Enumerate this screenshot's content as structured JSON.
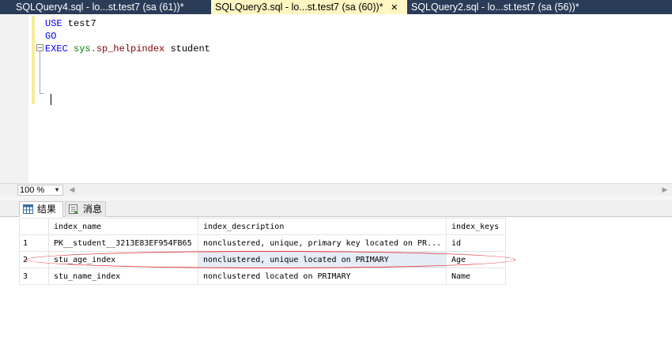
{
  "tabs": [
    {
      "title": "SQLQuery4.sql - lo...st.test7 (sa (61))*",
      "close": ""
    },
    {
      "title": "SQLQuery3.sql - lo...st.test7 (sa (60))*",
      "close": "✕"
    },
    {
      "title": "SQLQuery2.sql - lo...st.test7 (sa (56))*",
      "close": ""
    }
  ],
  "editor": {
    "line1": {
      "kw": "USE",
      "rest": " test7"
    },
    "line2": {
      "kw": "GO"
    },
    "line3": {
      "kw": "EXEC",
      "sys": " sys.",
      "proc": "sp_helpindex",
      "rest": " student"
    },
    "fold_symbol": "−"
  },
  "zoom": "100 %",
  "result_tabs": [
    {
      "label": "结果",
      "icon": "grid-icon"
    },
    {
      "label": "消息",
      "icon": "messages-icon"
    }
  ],
  "grid": {
    "columns": [
      "index_name",
      "index_description",
      "index_keys"
    ],
    "rows": [
      {
        "num": "1",
        "index_name": "PK__student__3213E83EF954FB65",
        "index_description": "nonclustered, unique, primary key located on PR...",
        "index_keys": "id"
      },
      {
        "num": "2",
        "index_name": "stu_age_index",
        "index_description": "nonclustered, unique located on PRIMARY",
        "index_keys": "Age"
      },
      {
        "num": "3",
        "index_name": "stu_name_index",
        "index_description": "nonclustered located on PRIMARY",
        "index_keys": "Name"
      }
    ]
  },
  "colors": {
    "tab_strip": "#2b3c59",
    "active_tab": "#fff6c2",
    "keyword": "#0000ff",
    "system_schema": "#008000",
    "procedure": "#800000",
    "annotation": "#e23232"
  }
}
